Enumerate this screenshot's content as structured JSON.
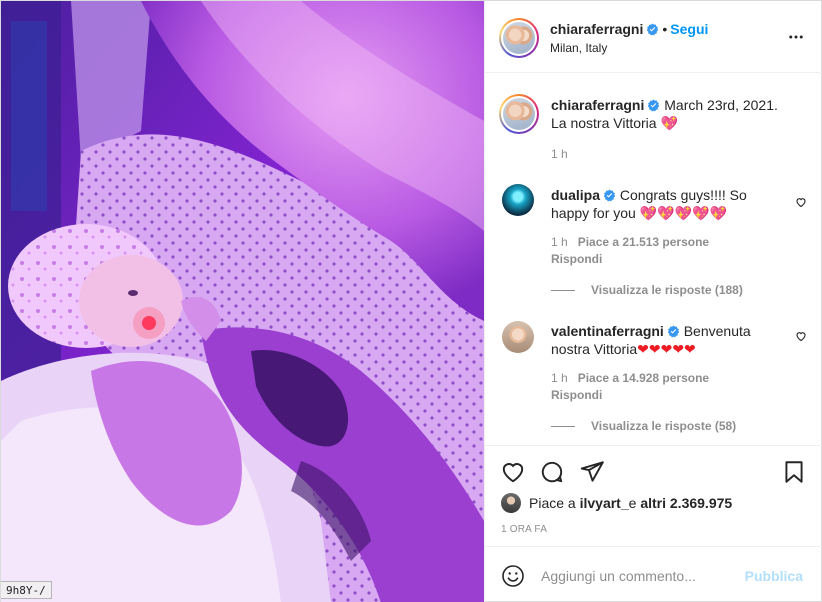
{
  "photo": {
    "url_fragment": "9h8Y-/"
  },
  "header": {
    "username": "chiaraferragni",
    "separator": "•",
    "follow_label": "Segui",
    "location": "Milan, Italy",
    "more_icon": "more-horizontal-icon"
  },
  "caption": {
    "username": "chiaraferragni",
    "text_line1": "March 23rd, 2021.",
    "text_line2": "La nostra Vittoria",
    "emoji": "💖",
    "time": "1 h"
  },
  "comments": [
    {
      "username": "dualipa",
      "text_part1": "Congrats guys!!!! So",
      "text_part2": "happy for you",
      "emoji": "💖💖💖💖💖",
      "time": "1 h",
      "likes": "Piace a 21.513 persone",
      "reply": "Rispondi",
      "view_replies": "Visualizza le risposte (188)"
    },
    {
      "username": "valentinaferragni",
      "text_part1": "Benvenuta",
      "text_part2": "nostra Vittoria",
      "emoji": "❤❤❤❤❤",
      "time": "1 h",
      "likes": "Piace a 14.928 persone",
      "reply": "Rispondi",
      "view_replies": "Visualizza le risposte (58)"
    }
  ],
  "likes_summary": {
    "prefix": "Piace a ",
    "user": "ilvyart_",
    "middle": " e ",
    "count": "altri 2.369.975"
  },
  "time_ago": "1 ORA FA",
  "comment_box": {
    "placeholder": "Aggiungi un commento...",
    "publish_label": "Pubblica"
  },
  "colors": {
    "accent": "#0095f6",
    "publish_disabled": "#b2dffc",
    "verified": "#3897f0",
    "photo_tint": "#7a1fd6"
  }
}
